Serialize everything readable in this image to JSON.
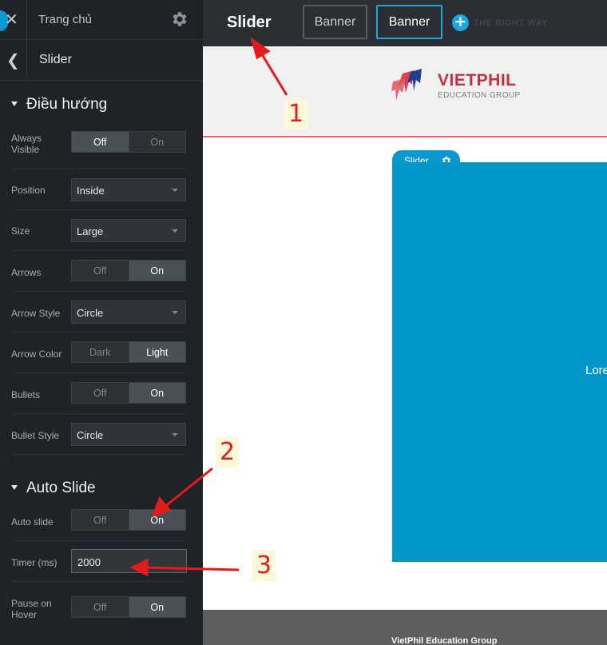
{
  "sidebar": {
    "home_label": "Trang chủ",
    "panel_title": "Slider",
    "icons": {
      "close": "close-icon",
      "settings": "gear-icon",
      "back": "chevron-left-icon"
    },
    "sections": [
      {
        "title": "Điều hướng",
        "rows": [
          {
            "label": "Always Visible",
            "type": "toggle",
            "options": [
              "Off",
              "On"
            ],
            "selected": "Off"
          },
          {
            "label": "Position",
            "type": "select",
            "value": "Inside"
          },
          {
            "label": "Size",
            "type": "select",
            "value": "Large"
          },
          {
            "label": "Arrows",
            "type": "toggle",
            "options": [
              "Off",
              "On"
            ],
            "selected": "On"
          },
          {
            "label": "Arrow Style",
            "type": "select",
            "value": "Circle"
          },
          {
            "label": "Arrow Color",
            "type": "toggle",
            "options": [
              "Dark",
              "Light"
            ],
            "selected": "Light"
          },
          {
            "label": "Bullets",
            "type": "toggle",
            "options": [
              "Off",
              "On"
            ],
            "selected": "On"
          },
          {
            "label": "Bullet Style",
            "type": "select",
            "value": "Circle"
          }
        ]
      },
      {
        "title": "Auto Slide",
        "rows": [
          {
            "label": "Auto slide",
            "type": "toggle",
            "options": [
              "Off",
              "On"
            ],
            "selected": "On"
          },
          {
            "label": "Timer (ms)",
            "type": "input",
            "value": "2000"
          },
          {
            "label": "Pause on Hover",
            "type": "toggle",
            "options": [
              "Off",
              "On"
            ],
            "selected": "On"
          }
        ]
      }
    ]
  },
  "topbar": {
    "title": "Slider",
    "tabs": [
      {
        "label": "Banner",
        "active": false
      },
      {
        "label": "Banner",
        "active": true
      }
    ],
    "add_icon": "plus-circle-icon",
    "ghost_text": "THE RIGHT WAY"
  },
  "canvas": {
    "logo_name": "VIETPHIL",
    "logo_sub": "EDUCATION GROUP",
    "slider_tab_label": "Slider",
    "slider_text": "Lore",
    "footer_text": "VietPhil Education Group"
  },
  "annotations": [
    "1",
    "2",
    "3"
  ],
  "colors": {
    "accent": "#1ea6e0",
    "slider_bg": "#0396c9",
    "sidebar_bg": "#1f2226",
    "brand_red": "#c72f3f",
    "annotation": "#e21b1b"
  }
}
